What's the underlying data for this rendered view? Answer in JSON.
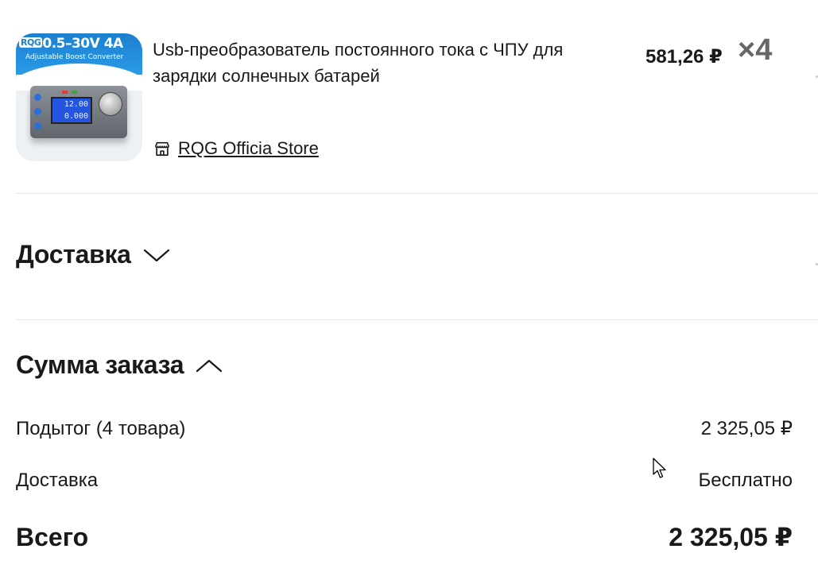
{
  "product": {
    "image_alt": "RQG 0.5–30V 4A Adjustable Boost Converter",
    "image_title": "0.5–30V 4A",
    "image_logo": "RQG",
    "image_subtitle": "Adjustable Boost Converter",
    "image_lcd_line1": "12.00",
    "image_lcd_line2": "0.000",
    "title": "Usb-преобразователь постоянного тока с ЧПУ для зарядки солнечных батарей",
    "price": "581,26 ₽",
    "quantity": "×4",
    "store_icon": "store-icon",
    "store_name": "RQG Officia Store"
  },
  "delivery_section": {
    "title": "Доставка",
    "state": "collapsed",
    "icon": "chevron-down-icon"
  },
  "order_summary": {
    "title": "Сумма заказа",
    "state": "expanded",
    "icon": "chevron-up-icon",
    "rows": [
      {
        "label": "Подытог (4 товара)",
        "value": "2 325,05 ₽"
      },
      {
        "label": "Доставка",
        "value": "Бесплатно"
      }
    ],
    "total": {
      "label": "Всего",
      "value": "2 325,05 ₽"
    }
  },
  "colors": {
    "text": "#191919",
    "muted": "#666666",
    "divider": "#e5e5e5"
  }
}
